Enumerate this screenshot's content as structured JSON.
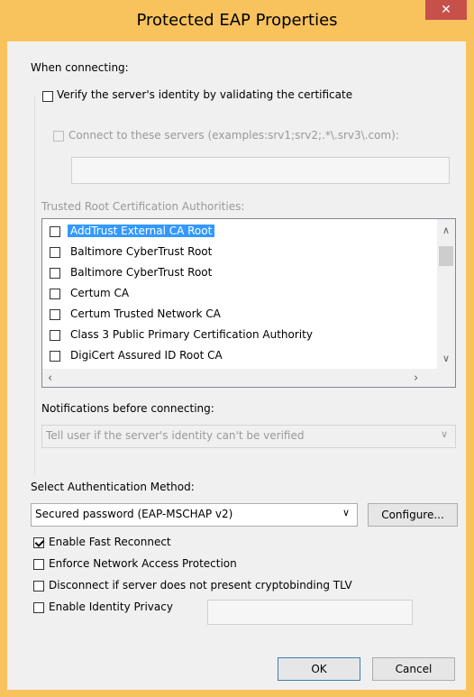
{
  "window": {
    "title": "Protected EAP Properties",
    "close_label": "✕"
  },
  "connecting": {
    "heading": "When connecting:",
    "verify_label": "Verify the server's identity by validating the certificate",
    "verify_checked": false,
    "connect_servers_label": "Connect to these servers (examples:srv1;srv2;.*\\.srv3\\.com):",
    "connect_servers_value": "",
    "trusted_heading": "Trusted Root Certification Authorities:",
    "authorities": [
      {
        "label": "AddTrust External CA Root",
        "checked": false,
        "selected": true
      },
      {
        "label": "Baltimore CyberTrust Root",
        "checked": false,
        "selected": false
      },
      {
        "label": "Baltimore CyberTrust Root",
        "checked": false,
        "selected": false
      },
      {
        "label": "Certum CA",
        "checked": false,
        "selected": false
      },
      {
        "label": "Certum Trusted Network CA",
        "checked": false,
        "selected": false
      },
      {
        "label": "Class 3 Public Primary Certification Authority",
        "checked": false,
        "selected": false
      },
      {
        "label": "DigiCert Assured ID Root CA",
        "checked": false,
        "selected": false
      }
    ],
    "notifications_heading": "Notifications before connecting:",
    "notifications_value": "Tell user if the server's identity can't be verified"
  },
  "auth": {
    "heading": "Select Authentication Method:",
    "method_value": "Secured password (EAP-MSCHAP v2)",
    "configure_label": "Configure..."
  },
  "options": {
    "fast_reconnect_label": "Enable Fast Reconnect",
    "fast_reconnect_checked": true,
    "nap_label": "Enforce Network Access Protection",
    "nap_checked": false,
    "cryptobinding_label": "Disconnect if server does not present cryptobinding TLV",
    "cryptobinding_checked": false,
    "identity_privacy_label": "Enable Identity Privacy",
    "identity_privacy_checked": false,
    "identity_privacy_value": ""
  },
  "buttons": {
    "ok_label": "OK",
    "cancel_label": "Cancel"
  },
  "icons": {
    "scroll_up": "scroll-up-arrow-icon",
    "scroll_down": "scroll-down-arrow-icon",
    "scroll_left": "scroll-left-arrow-icon",
    "scroll_right": "scroll-right-arrow-icon",
    "dropdown": "chevron-down-icon"
  },
  "colors": {
    "frame": "#f8c35d",
    "close_button": "#c7504b",
    "selection": "#3399ff"
  }
}
